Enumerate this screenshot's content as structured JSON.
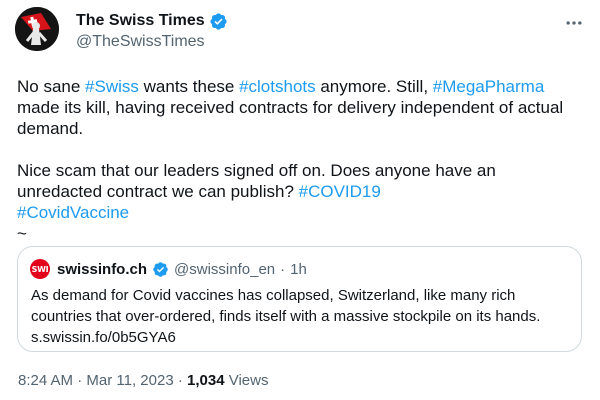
{
  "tweet": {
    "author": {
      "name": "The Swiss Times",
      "handle": "@TheSwissTimes",
      "verified": true
    },
    "text": {
      "p1_a": "No sane ",
      "p1_tag1": "#Swiss",
      "p1_b": " wants these ",
      "p1_tag2": "#clotshots",
      "p1_c": " anymore. Still, ",
      "p1_tag3": "#MegaPharma",
      "p1_d": " made its kill, having received contracts for delivery independent of actual demand.",
      "p2_a": "Nice scam that our leaders signed off on. Does anyone have an unredacted contract we can publish? ",
      "p2_tag1": "#COVID19",
      "p2_tag2": "#CovidVaccine",
      "p3": "~"
    },
    "quote": {
      "logo_text": "SWI",
      "name": "swissinfo.ch",
      "handle": "@swissinfo_en",
      "dot": "·",
      "time": "1h",
      "text": "As demand for Covid vaccines has collapsed, Switzerland, like many rich countries that over-ordered, finds itself with a massive stockpile on its hands.",
      "link": "s.swissin.fo/0b5GYA6"
    },
    "meta": {
      "time": "8:24 AM",
      "sep1": " · ",
      "date": "Mar 11, 2023",
      "sep2": " · ",
      "views": "1,034",
      "views_label": " Views"
    }
  },
  "colors": {
    "link": "#1d9bf0",
    "text": "#0f1419",
    "secondary": "#536471",
    "border": "#cfd9de",
    "verified": "#1d9bf0",
    "swi_red": "#e2001a"
  },
  "icons": {
    "more": "more-horizontal-icon",
    "verified": "verified-badge-icon"
  }
}
